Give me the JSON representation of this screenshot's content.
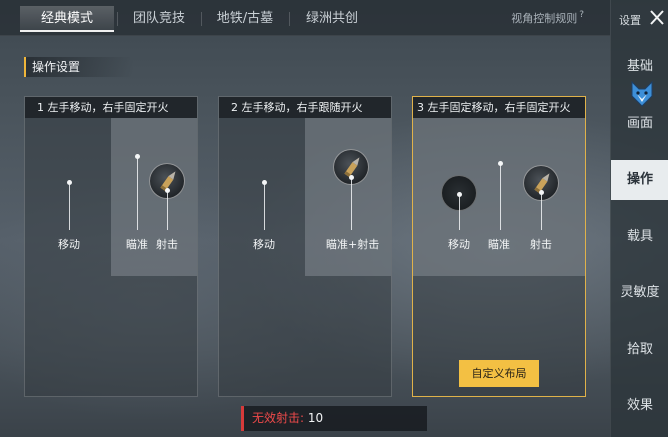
{
  "top_tabs": [
    {
      "label": "经典模式",
      "active": true
    },
    {
      "label": "团队竞技",
      "active": false
    },
    {
      "label": "地铁/古墓",
      "active": false
    },
    {
      "label": "绿洲共创",
      "active": false
    }
  ],
  "view_rules": {
    "label": "视角控制规则",
    "mark": "?"
  },
  "sidebar": {
    "title": "设置",
    "items": [
      {
        "label": "基础"
      },
      {
        "label": "画面"
      },
      {
        "label": "操作",
        "active": true
      },
      {
        "label": "载具"
      },
      {
        "label": "灵敏度"
      },
      {
        "label": "拾取"
      },
      {
        "label": "效果"
      }
    ]
  },
  "section": {
    "title": "操作设置"
  },
  "cards": [
    {
      "title": "1 左手移动，右手固定开火",
      "move": "移动",
      "aim": "瞄准",
      "fire": "射击"
    },
    {
      "title": "2 左手移动，右手跟随开火",
      "move": "移动",
      "aim_fire": "瞄准+射击"
    },
    {
      "title": "3 左手固定移动，右手固定开火",
      "move": "移动",
      "aim": "瞄准",
      "fire": "射击",
      "custom_button": "自定义布局",
      "selected": true
    }
  ],
  "invalid_shot": {
    "label": "无效射击:",
    "value": "10"
  },
  "colors": {
    "accent": "#f3c043",
    "alert": "#ee4a4a",
    "selected_border": "#e0b24a"
  }
}
